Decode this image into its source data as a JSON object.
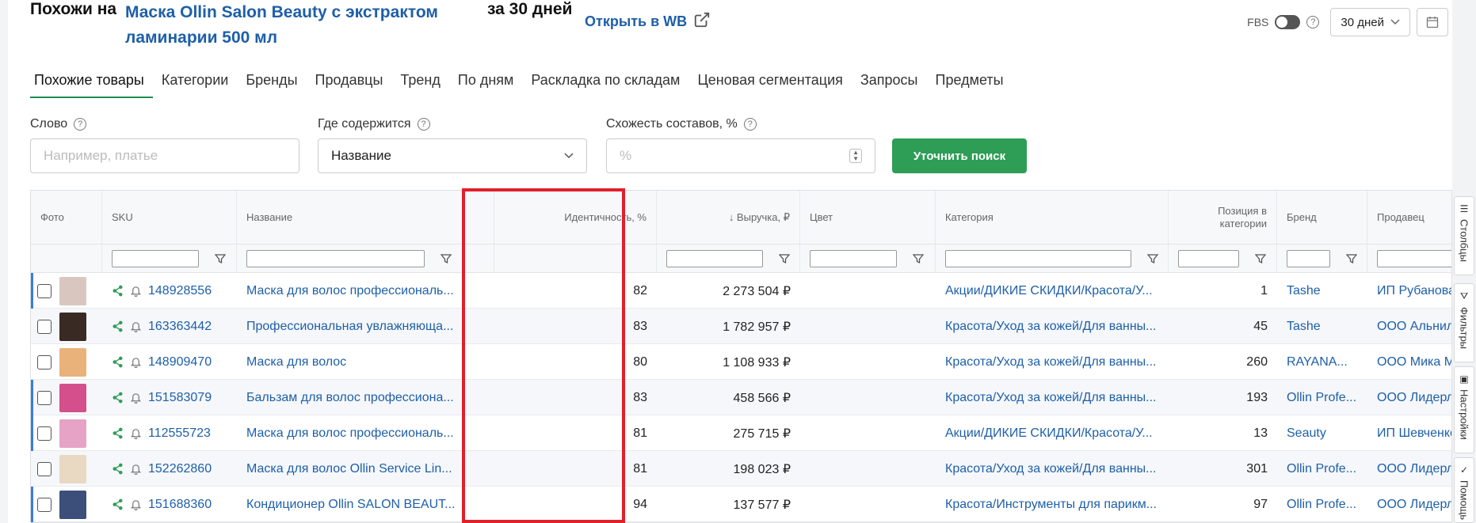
{
  "header": {
    "title_prefix": "Похожи на",
    "product_name": "Маска Ollin Salon Beauty с экстрактом ламинарии 500 мл",
    "title_suffix": "за 30 дней",
    "open_wb_label": "Открыть в WB",
    "fbs_label": "FBS",
    "period": "30 дней"
  },
  "tabs": [
    {
      "label": "Похожие товары",
      "active": true
    },
    {
      "label": "Категории"
    },
    {
      "label": "Бренды"
    },
    {
      "label": "Продавцы"
    },
    {
      "label": "Тренд"
    },
    {
      "label": "По дням"
    },
    {
      "label": "Раскладка по складам"
    },
    {
      "label": "Ценовая сегментация"
    },
    {
      "label": "Запросы"
    },
    {
      "label": "Предметы"
    }
  ],
  "filters": {
    "word_label": "Слово",
    "word_placeholder": "Например, платье",
    "where_label": "Где содержится",
    "where_value": "Название",
    "similarity_label": "Схожесть составов, %",
    "similarity_placeholder": "%",
    "search_button": "Уточнить поиск"
  },
  "table": {
    "columns": {
      "photo": "Фото",
      "sku": "SKU",
      "name": "Название",
      "identity": "Идентичность, %",
      "revenue": "↓ Выручка, ₽",
      "color": "Цвет",
      "category": "Категория",
      "position": "Позиция в категории",
      "brand": "Бренд",
      "seller": "Продавец"
    },
    "rows": [
      {
        "sku": "148928556",
        "name": "Маска для волос профессиональ...",
        "identity": "82",
        "revenue": "2 273 504 ₽",
        "category": "Акции/ДИКИЕ СКИДКИ/Красота/У...",
        "position": "1",
        "brand": "Tashe",
        "seller": "ИП Рубанова Та",
        "marked": true,
        "thumb": "#d9c7bf"
      },
      {
        "sku": "163363442",
        "name": "Профессиональная увлажняюща...",
        "identity": "83",
        "revenue": "1 782 957 ₽",
        "category": "Красота/Уход за кожей/Для ванны...",
        "position": "45",
        "brand": "Tashe",
        "seller": "ООО Альнилам",
        "marked": false,
        "thumb": "#3a2a24"
      },
      {
        "sku": "148909470",
        "name": "Маска для волос",
        "identity": "80",
        "revenue": "1 108 933 ₽",
        "category": "Красота/Уход за кожей/Для ванны...",
        "position": "260",
        "brand": "RAYANA...",
        "seller": "ООО Мика Мед",
        "marked": false,
        "thumb": "#e8b27a"
      },
      {
        "sku": "151583079",
        "name": "Бальзам для волос профессиона...",
        "identity": "83",
        "revenue": "458 566 ₽",
        "category": "Красота/Уход за кожей/Для ванны...",
        "position": "193",
        "brand": "Ollin Profe...",
        "seller": "ООО Лидерлай",
        "marked": true,
        "thumb": "#d44f8c"
      },
      {
        "sku": "112555723",
        "name": "Маска для волос профессиональ...",
        "identity": "81",
        "revenue": "275 715 ₽",
        "category": "Акции/ДИКИЕ СКИДКИ/Красота/У...",
        "position": "13",
        "brand": "Seauty",
        "seller": "ИП Шевченко Г",
        "marked": true,
        "thumb": "#e6a3c6"
      },
      {
        "sku": "152262860",
        "name": "Маска для волос Ollin Service Lin...",
        "identity": "81",
        "revenue": "198 023 ₽",
        "category": "Красота/Уход за кожей/Для ванны...",
        "position": "301",
        "brand": "Ollin Profe...",
        "seller": "ООО Лидерлай",
        "marked": false,
        "thumb": "#e9d9c3"
      },
      {
        "sku": "151688360",
        "name": "Кондиционер Ollin SALON BEAUT...",
        "identity": "94",
        "revenue": "137 577 ₽",
        "category": "Красота/Инструменты для парикм...",
        "position": "97",
        "brand": "Ollin Profe...",
        "seller": "ООО Лидерлай",
        "marked": true,
        "thumb": "#3b4f7a"
      }
    ]
  },
  "side_tabs": [
    {
      "label": "Столбцы"
    },
    {
      "label": "Фильтры"
    },
    {
      "label": "Настройки"
    },
    {
      "label": "Помощь"
    }
  ]
}
